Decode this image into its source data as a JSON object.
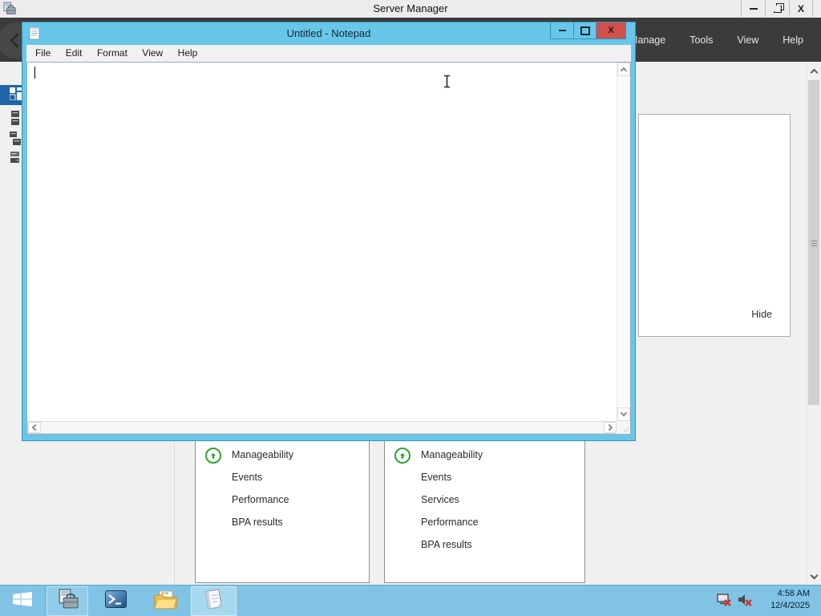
{
  "server_manager": {
    "title": "Server Manager",
    "window_controls": {
      "close_glyph": "X"
    },
    "menubar": {
      "manage": "Manage",
      "tools": "Tools",
      "view": "View",
      "help": "Help"
    },
    "dashboard_tiles": [
      {
        "rows": [
          {
            "label": "Manageability",
            "status_icon": "green-up-arrow"
          },
          {
            "label": "Events"
          },
          {
            "label": "Performance"
          },
          {
            "label": "BPA results"
          }
        ]
      },
      {
        "rows": [
          {
            "label": "Manageability",
            "status_icon": "green-up-arrow"
          },
          {
            "label": "Events"
          },
          {
            "label": "Services"
          },
          {
            "label": "Performance"
          },
          {
            "label": "BPA results"
          }
        ]
      }
    ],
    "notification_panel": {
      "hide_label": "Hide"
    }
  },
  "notepad": {
    "title": "Untitled - Notepad",
    "menu": [
      "File",
      "Edit",
      "Format",
      "View",
      "Help"
    ],
    "content": "",
    "close_glyph": "X"
  },
  "taskbar": {
    "clock": {
      "time": "4:58 AM",
      "date": "12/4/2025"
    }
  },
  "icons": {
    "back_arrow": "chevron-left",
    "status_up": "green-circled-up-arrow",
    "tray_network": "network-disconnected-red-x",
    "tray_sound": "speaker-muted-red-x"
  },
  "colors": {
    "accent_blue": "#68C7E9",
    "taskbar_blue": "#80C3E5",
    "header_dark": "#3B3B3B",
    "selected_nav_blue": "#1E64A8",
    "close_red": "#D0504B",
    "status_green": "#2AA52F"
  }
}
